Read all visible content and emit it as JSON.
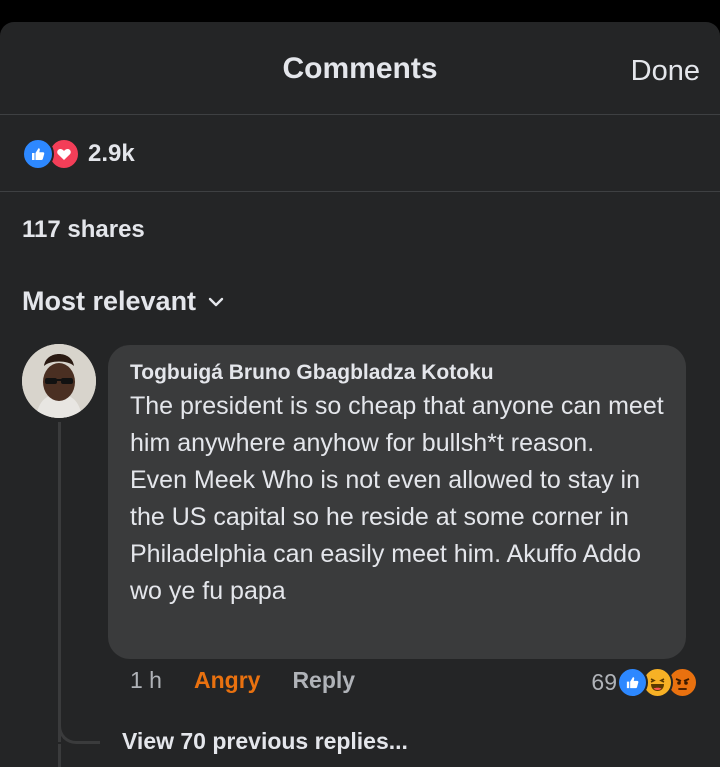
{
  "header": {
    "title": "Comments",
    "done_label": "Done"
  },
  "reactions": {
    "icons": [
      "like-icon",
      "love-icon"
    ],
    "count": "2.9k",
    "colors": {
      "like": "#2d88ff",
      "love": "#f33e58"
    }
  },
  "shares": "117 shares",
  "sort": {
    "label": "Most relevant",
    "icon": "chevron-down-icon"
  },
  "comment": {
    "author": "Togbuigá Bruno Gbagbladza Kotoku",
    "text": "The president is so cheap that anyone can meet him anywhere anyhow for bullsh*t reason.  Even Meek Who is not even allowed to stay in the US capital so he reside at some corner in Philadelphia can easily meet him. Akuffo Addo wo ye fu papa",
    "time": "1 h",
    "user_reaction": "Angry",
    "reply_label": "Reply",
    "reaction_count": "69",
    "reaction_icons": [
      "like-icon",
      "haha-icon",
      "angry-icon"
    ],
    "accent_colors": {
      "angry": "#e9710f"
    }
  },
  "replies": {
    "label": "View 70 previous replies..."
  }
}
